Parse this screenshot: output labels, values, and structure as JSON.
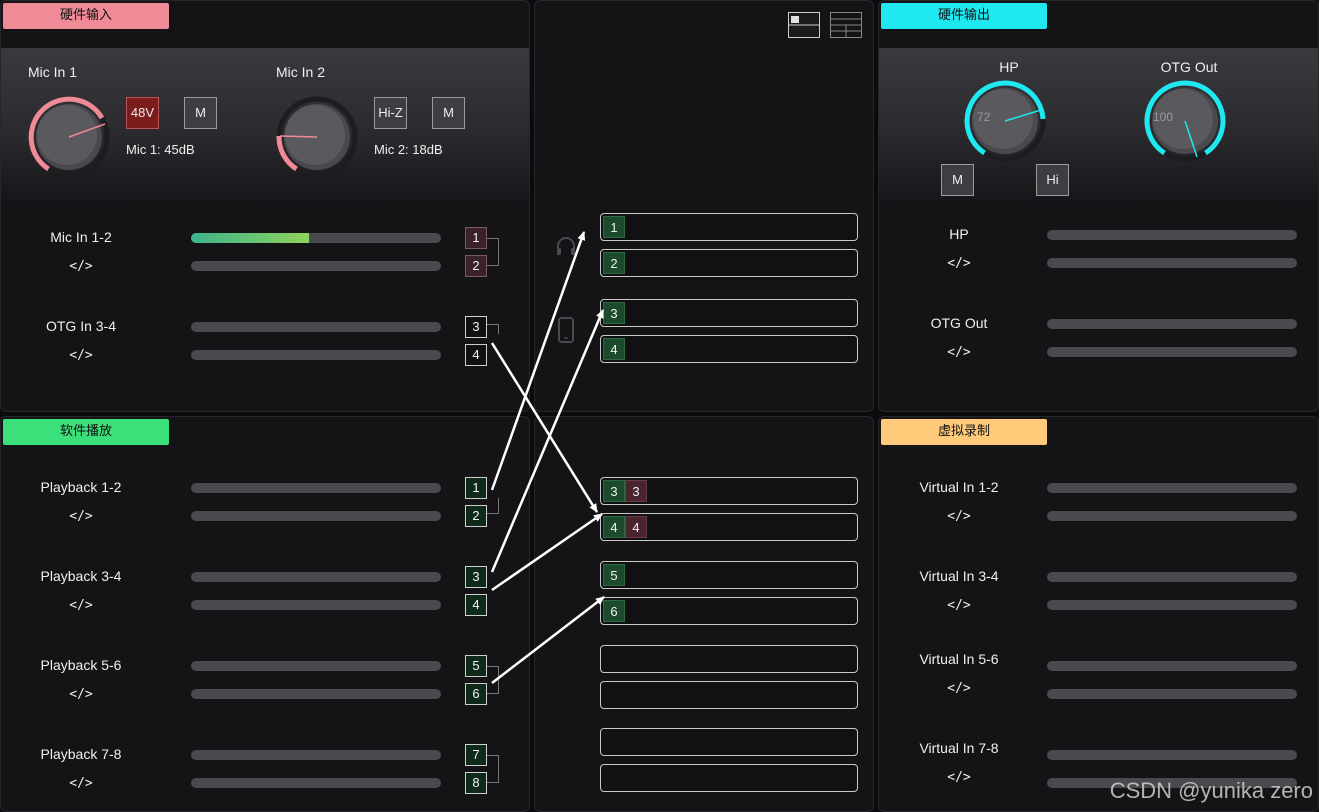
{
  "hw_input": {
    "tag": "硬件输入",
    "tag_color": "#f08a96",
    "mic1": {
      "title": "Mic In 1",
      "phantom": "48V",
      "mute": "M",
      "gain_text": "Mic 1: 45dB"
    },
    "mic2": {
      "title": "Mic In 2",
      "hiz": "Hi-Z",
      "mute": "M",
      "gain_text": "Mic 2: 18dB"
    },
    "rows": [
      {
        "name": "Mic In 1-2",
        "code": "</>",
        "ch_a": "1",
        "ch_b": "2",
        "level": 0.47
      },
      {
        "name": "OTG In 3-4",
        "code": "</>",
        "ch_a": "3",
        "ch_b": "4",
        "level": 0
      }
    ]
  },
  "hw_output": {
    "tag": "硬件输出",
    "tag_color": "#1fe8f0",
    "hp": {
      "title": "HP",
      "value": "72",
      "mute": "M",
      "hi": "Hi"
    },
    "otg": {
      "title": "OTG Out",
      "value": "100"
    },
    "rows": [
      {
        "name": "HP",
        "code": "</>"
      },
      {
        "name": "OTG Out",
        "code": "</>"
      }
    ]
  },
  "sw_playback": {
    "tag": "软件播放",
    "tag_color": "#3be07a",
    "rows": [
      {
        "name": "Playback 1-2",
        "code": "</>",
        "ch_a": "1",
        "ch_b": "2"
      },
      {
        "name": "Playback 3-4",
        "code": "</>",
        "ch_a": "3",
        "ch_b": "4"
      },
      {
        "name": "Playback 5-6",
        "code": "</>",
        "ch_a": "5",
        "ch_b": "6"
      },
      {
        "name": "Playback 7-8",
        "code": "</>",
        "ch_a": "7",
        "ch_b": "8"
      }
    ]
  },
  "virtual_rec": {
    "tag": "虚拟录制",
    "tag_color": "#ffca7a",
    "rows": [
      {
        "name": "Virtual In 1-2",
        "code": "</>"
      },
      {
        "name": "Virtual In 3-4",
        "code": "</>"
      },
      {
        "name": "Virtual In 5-6",
        "code": "</>"
      },
      {
        "name": "Virtual In 7-8",
        "code": "</>"
      }
    ]
  },
  "routing": {
    "view_icons": [
      "layout-single-icon",
      "layout-grid-icon"
    ],
    "hp_icon": "headphones-icon",
    "phone_icon": "phone-icon",
    "output_slots": [
      {
        "chips": [
          {
            "t": "1",
            "c": "g"
          }
        ]
      },
      {
        "chips": [
          {
            "t": "2",
            "c": "g"
          }
        ]
      },
      {
        "chips": [
          {
            "t": "3",
            "c": "g"
          }
        ]
      },
      {
        "chips": [
          {
            "t": "4",
            "c": "g"
          }
        ]
      }
    ],
    "virtual_slots": [
      {
        "chips": [
          {
            "t": "3",
            "c": "g"
          },
          {
            "t": "3",
            "c": "r"
          }
        ]
      },
      {
        "chips": [
          {
            "t": "4",
            "c": "g"
          },
          {
            "t": "4",
            "c": "r"
          }
        ]
      },
      {
        "chips": [
          {
            "t": "5",
            "c": "g"
          }
        ]
      },
      {
        "chips": [
          {
            "t": "6",
            "c": "g"
          }
        ]
      },
      {
        "chips": []
      },
      {
        "chips": []
      },
      {
        "chips": []
      },
      {
        "chips": []
      }
    ]
  },
  "watermark": "CSDN @yunika zero"
}
